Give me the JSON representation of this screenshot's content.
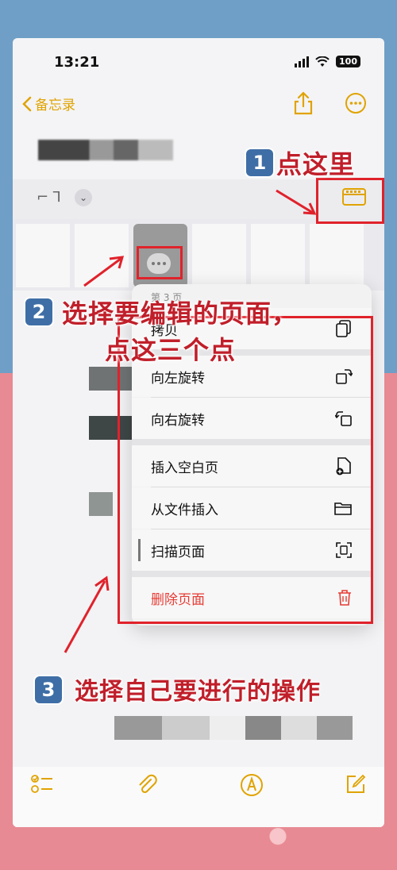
{
  "status": {
    "time": "13:21",
    "battery": "100"
  },
  "nav": {
    "back_label": "备忘录"
  },
  "menu": {
    "page_header": "第 3 页",
    "copy": "拷贝",
    "rotate_left": "向左旋转",
    "rotate_right": "向右旋转",
    "insert_blank": "插入空白页",
    "insert_from_file": "从文件插入",
    "scan_page": "扫描页面",
    "delete_page": "删除页面"
  },
  "annotations": {
    "step1_num": "1",
    "step1_text": "点这里",
    "step2_num": "2",
    "step2_text_line1": "选择要编辑的页面，",
    "step2_text_line2": "点这三个点",
    "step3_num": "3",
    "step3_text": "选择自己要进行的操作"
  },
  "colors": {
    "accent": "#e0a300",
    "highlight": "#e0222b",
    "destructive": "#e63c35",
    "annotation": "#c01f2a"
  },
  "icons": {
    "back": "chevron-left-icon",
    "share": "share-icon",
    "more": "ellipsis-circle-icon",
    "thumbnails": "thumbnails-icon",
    "copy": "copy-icon",
    "rotate_left": "rotate-left-icon",
    "rotate_right": "rotate-right-icon",
    "insert_blank": "doc-plus-icon",
    "insert_file": "folder-icon",
    "scan": "scan-icon",
    "delete": "trash-icon",
    "checklist": "checklist-icon",
    "attach": "paperclip-icon",
    "markup": "pen-circle-icon",
    "compose": "compose-icon"
  }
}
